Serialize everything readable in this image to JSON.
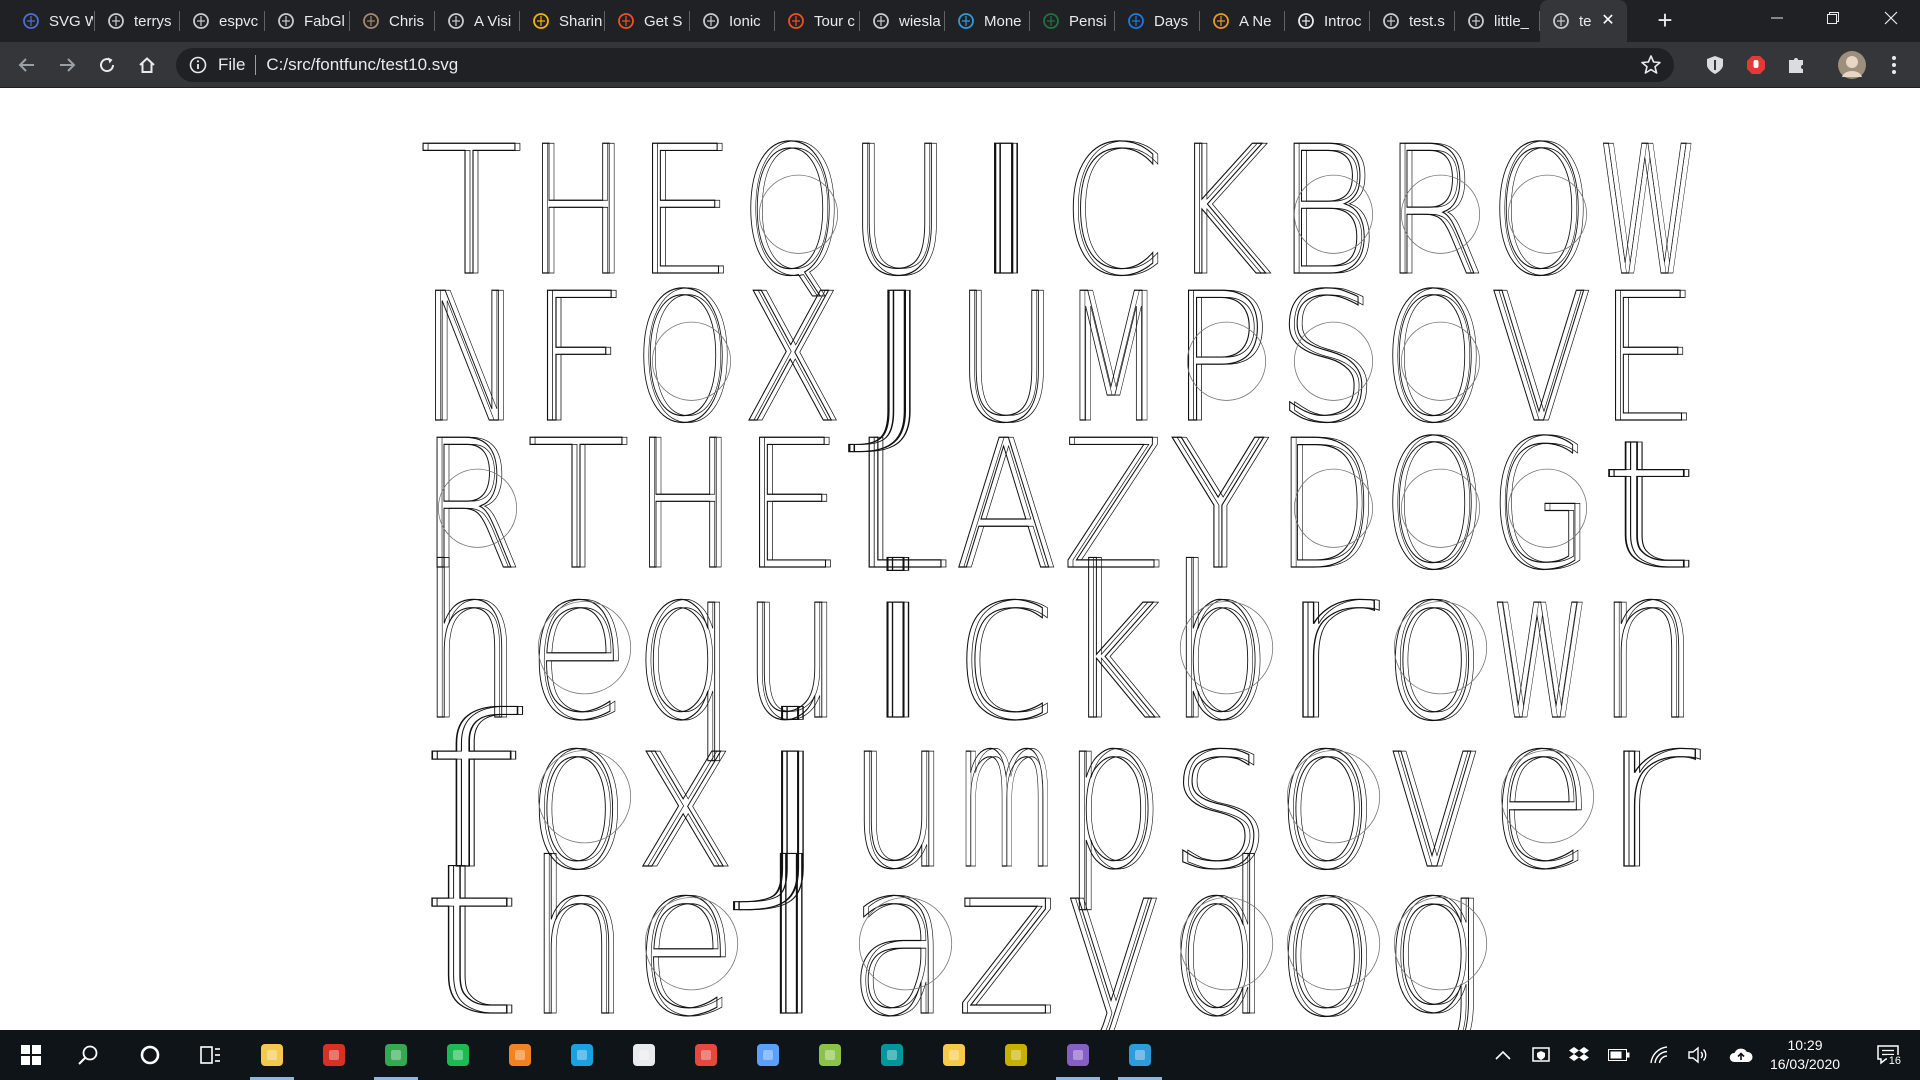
{
  "browser": {
    "tabs": [
      {
        "label": "SVG W",
        "icon": "svg-icon",
        "color": "#4f6fd1"
      },
      {
        "label": "terrys",
        "icon": "github-icon",
        "color": "#c9cacc"
      },
      {
        "label": "espvc",
        "icon": "github-icon",
        "color": "#c9cacc"
      },
      {
        "label": "FabGl",
        "icon": "globe-icon",
        "color": "#c9cacc"
      },
      {
        "label": "Chris",
        "icon": "photo-icon",
        "color": "#a58a6b"
      },
      {
        "label": "A Visi",
        "icon": "github-icon",
        "color": "#c9cacc"
      },
      {
        "label": "Sharin",
        "icon": "google-photos-icon",
        "color": "#f4b400"
      },
      {
        "label": "Get S",
        "icon": "microsoft-icon",
        "color": "#f25022"
      },
      {
        "label": "Ionic",
        "icon": "globe-icon",
        "color": "#c9cacc"
      },
      {
        "label": "Tour c",
        "icon": "microsoft-icon",
        "color": "#f25022"
      },
      {
        "label": "wiesla",
        "icon": "github-icon",
        "color": "#c9cacc"
      },
      {
        "label": "Mone",
        "icon": "monaco-icon",
        "color": "#2d9cdb"
      },
      {
        "label": "Pensi",
        "icon": "excel-icon",
        "color": "#1f7244"
      },
      {
        "label": "Days",
        "icon": "vsts-icon",
        "color": "#1d7ae0"
      },
      {
        "label": "A Ne",
        "icon": "sun-icon",
        "color": "#e89823"
      },
      {
        "label": "Introc",
        "icon": "graduation-icon",
        "color": "#e8eaed"
      },
      {
        "label": "test.s",
        "icon": "globe-icon",
        "color": "#c9cacc"
      },
      {
        "label": "little_",
        "icon": "globe-icon",
        "color": "#c9cacc"
      },
      {
        "label": "te",
        "icon": "globe-icon",
        "color": "#c9cacc",
        "active": true
      }
    ],
    "address": {
      "scheme_label": "File",
      "url": "C:/src/fontfunc/test10.svg"
    }
  },
  "svg_text": {
    "lines": [
      "THEQUICKBROW",
      "NFOXJUMPSOVE",
      "RTHELAZYDOGt",
      "hequickbrown",
      "foxjumpsover",
      "thelazydog"
    ]
  },
  "taskbar": {
    "apps": [
      {
        "name": "file-explorer-icon",
        "color": "#f2c94c",
        "running": true
      },
      {
        "name": "gmail-icon",
        "color": "#d93025",
        "running": false
      },
      {
        "name": "chrome-icon",
        "color": "#34a853",
        "running": true
      },
      {
        "name": "spotify-icon",
        "color": "#1db954",
        "running": false
      },
      {
        "name": "fusion-icon",
        "color": "#f58220",
        "running": false
      },
      {
        "name": "cortana-app-icon",
        "color": "#1ba1e2",
        "running": false
      },
      {
        "name": "notepad-icon",
        "color": "#e8eaed",
        "running": false
      },
      {
        "name": "xmind-icon",
        "color": "#e5483c",
        "running": false
      },
      {
        "name": "terminal-icon",
        "color": "#5aa0ff",
        "running": false
      },
      {
        "name": "notepadpp-icon",
        "color": "#8bc34a",
        "running": false
      },
      {
        "name": "arduino-icon",
        "color": "#00979c",
        "running": false
      },
      {
        "name": "bulb-icon",
        "color": "#f7c948",
        "running": false
      },
      {
        "name": "globe-app-icon",
        "color": "#c6b100",
        "running": false
      },
      {
        "name": "visual-studio-icon",
        "color": "#865fc5",
        "running": true
      },
      {
        "name": "vscode-icon",
        "color": "#2d9cdb",
        "running": true
      }
    ],
    "clock_time": "10:29",
    "clock_date": "16/03/2020",
    "notification_count": "16"
  }
}
